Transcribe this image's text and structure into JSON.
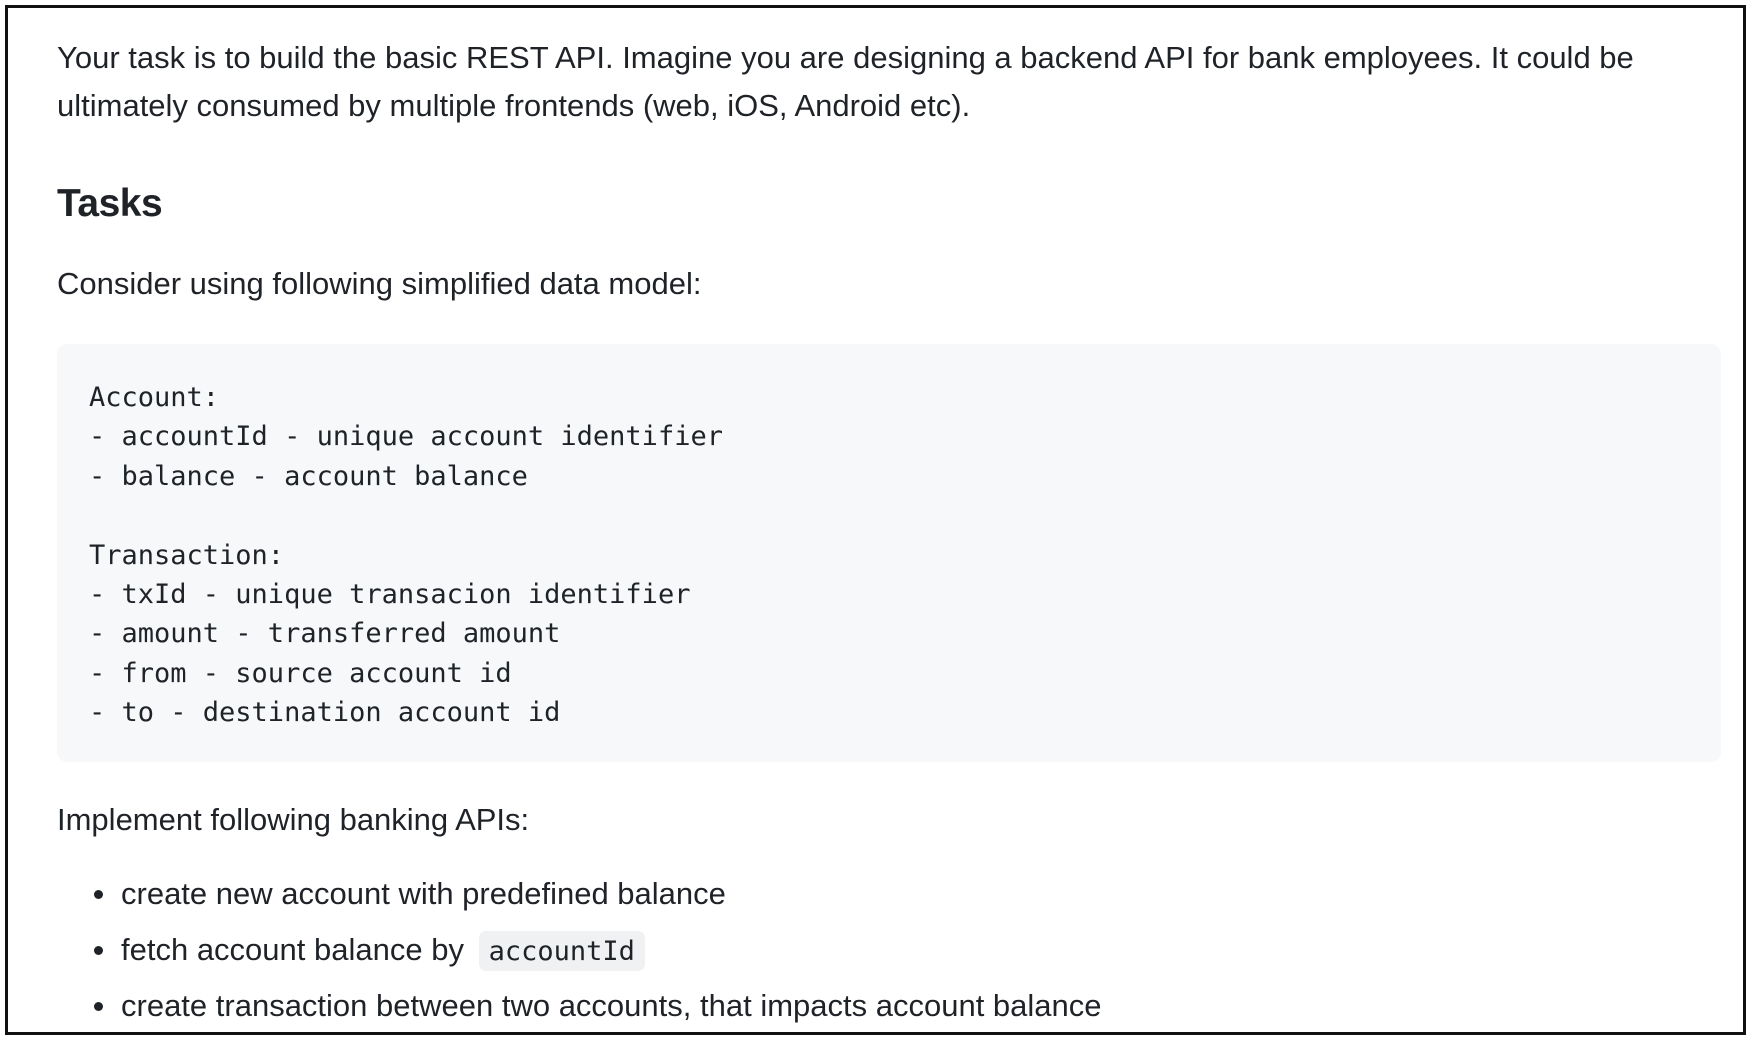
{
  "intro": "Your task is to build the basic REST API. Imagine you are designing a backend API for bank employees. It could be ultimately consumed by multiple frontends (web, iOS, Android etc).",
  "tasks_heading": "Tasks",
  "data_model_intro": "Consider using following simplified data model:",
  "code_lines": [
    "Account:",
    "- accountId - unique account identifier",
    "- balance - account balance",
    "",
    "Transaction:",
    "- txId - unique transacion identifier",
    "- amount - transferred amount",
    "- from - source account id",
    "- to - destination account id"
  ],
  "apis_intro": "Implement following banking APIs:",
  "api_items": [
    {
      "text": "create new account with predefined balance",
      "code": ""
    },
    {
      "text": "fetch account balance by",
      "code": "accountId"
    },
    {
      "text": "create transaction between two accounts, that impacts account balance",
      "code": ""
    }
  ]
}
